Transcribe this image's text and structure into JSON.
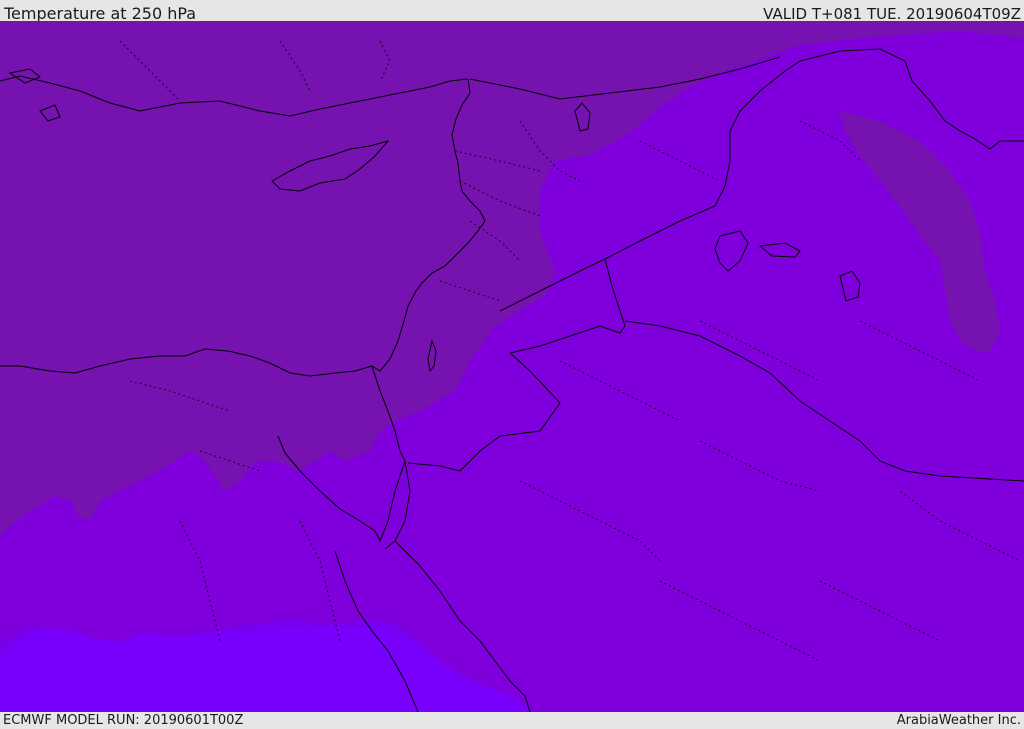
{
  "header": {
    "title": "Temperature at 250 hPa",
    "valid": "VALID T+081 TUE. 20190604T09Z"
  },
  "footer": {
    "model_run": "ECMWF MODEL RUN: 20190601T00Z",
    "credit": "ArabiaWeather Inc."
  },
  "map": {
    "colors": {
      "band_coldest": "#7612b0",
      "band_cold": "#7f00dc",
      "band_mid": "#7600ef",
      "band_warm": "#7a00ff",
      "coast_lines": "#000000",
      "borders": "#1a0033"
    }
  }
}
